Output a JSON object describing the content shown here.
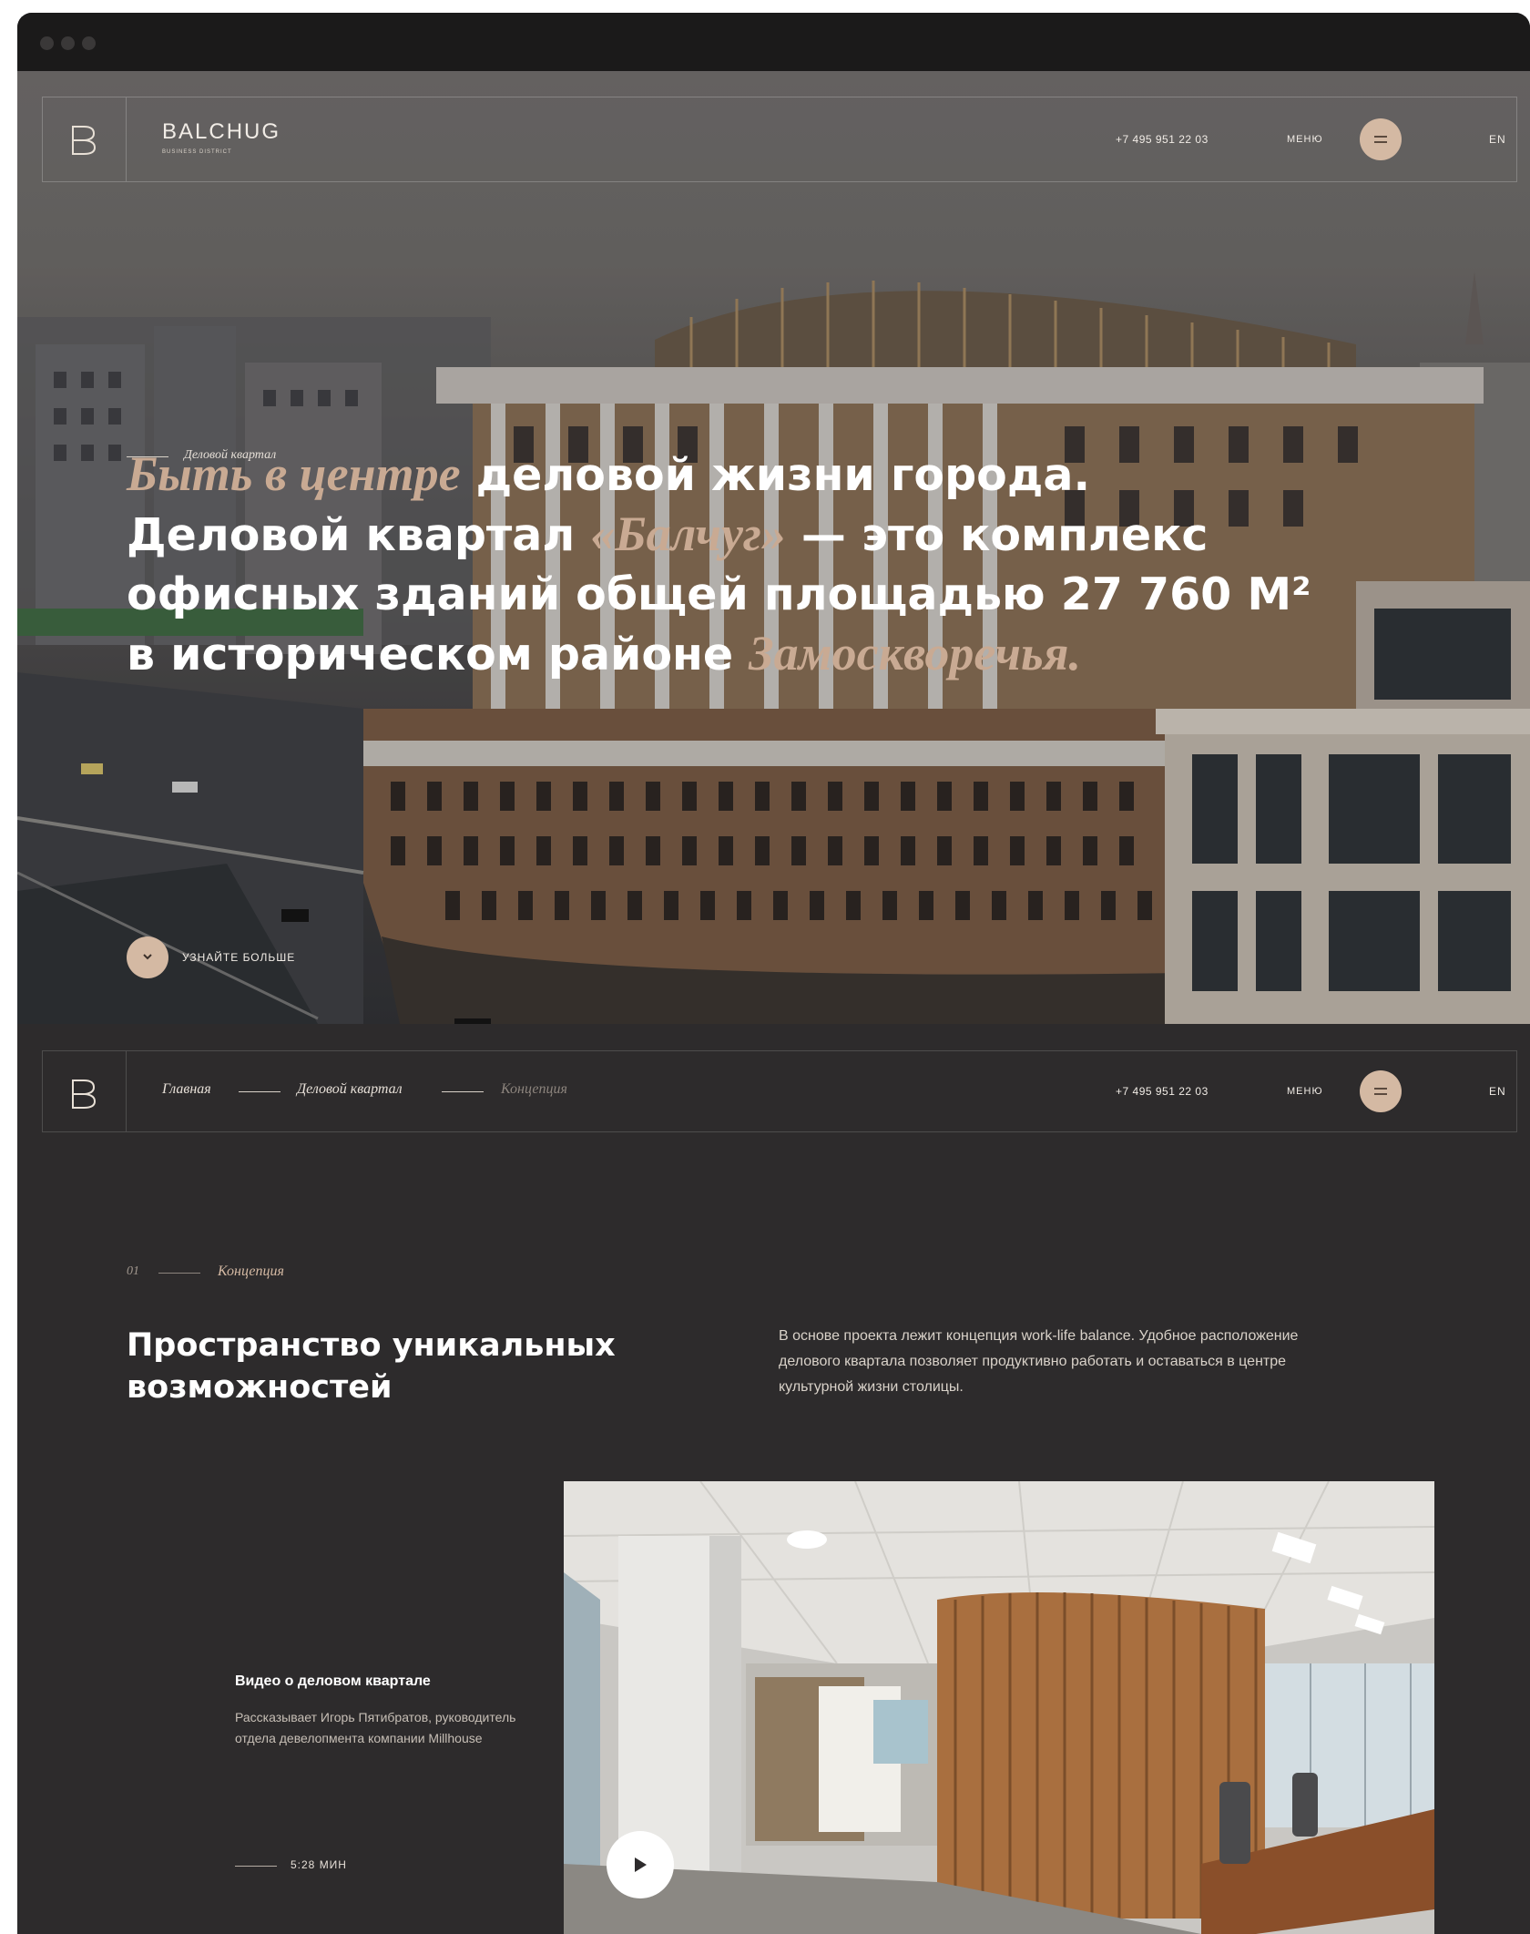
{
  "header": {
    "brand": "BALCHUG",
    "brand_sub": "BUSINESS DISTRICT",
    "phone": "+7 495 951 22 03",
    "menu_label": "МЕНЮ",
    "lang": "EN"
  },
  "hero": {
    "eyebrow": "Деловой квартал",
    "headline": {
      "line1_accent": "Быть в центре",
      "line1_rest": " деловой жизни города.",
      "line2_pre": "Деловой квартал ",
      "line2_accent": "«Балчуг»",
      "line2_rest": " — это комплекс",
      "line3": "офисных зданий общей площадью 27 760 М²",
      "line4_pre": "в историческом районе ",
      "line4_accent": "Замоскворечья."
    },
    "learn_more": "УЗНАЙТЕ БОЛЬШЕ"
  },
  "breadcrumb": {
    "items": [
      "Главная",
      "Деловой квартал",
      "Концепция"
    ]
  },
  "concept": {
    "number": "01",
    "label": "Концепция",
    "title": "Пространство уникальных возможностей",
    "lead": "В основе проекта лежит концепция work-life balance. Удобное расположение делового квартала позволяет продуктивно работать и оставаться в центре культурной жизни столицы.",
    "video_title": "Видео о деловом квартале",
    "video_desc": "Рассказывает Игорь Пятибратов, руководитель отдела девелопмента компании Millhouse",
    "duration": "5:28 МИН"
  },
  "colors": {
    "accent": "#d4b9a3",
    "accent_text": "#c9aa93",
    "dark_bg": "#2d2b2c",
    "chrome": "#1b1a1a"
  },
  "icons": [
    "logo-b-icon",
    "menu-icon",
    "chevron-down-icon",
    "play-icon"
  ]
}
